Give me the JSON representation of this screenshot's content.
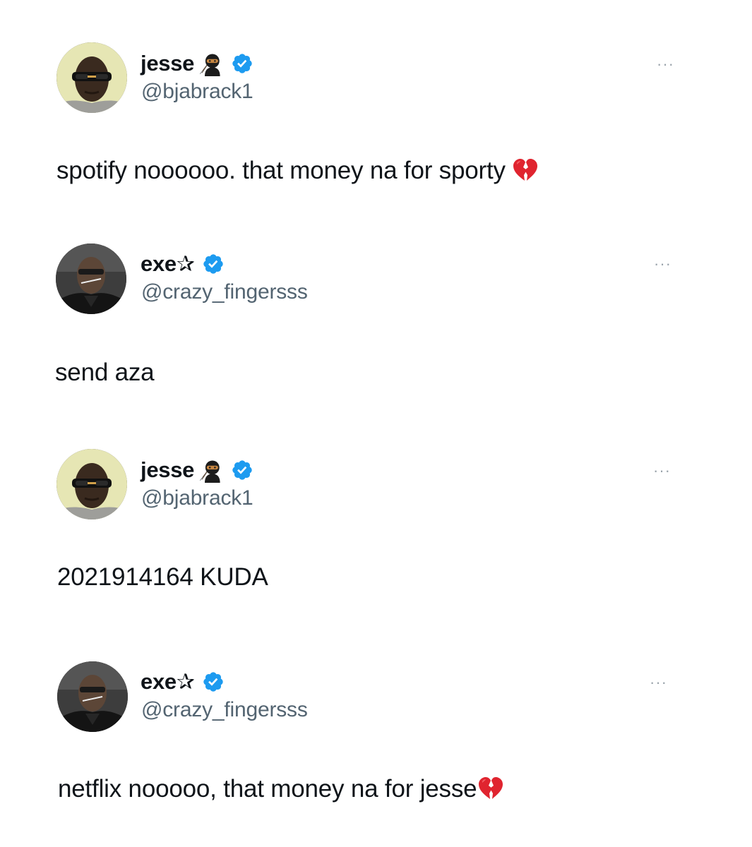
{
  "tweets": [
    {
      "display_name": "jesse",
      "name_emoji": "ninja-emoji",
      "verified": true,
      "handle": "@bjabrack1",
      "more": "···",
      "text": "spotify noooooo. that money na for sporty",
      "trailing_emoji": "broken-heart-emoji"
    },
    {
      "display_name": "exe✰",
      "verified": true,
      "handle": "@crazy_fingersss",
      "more": "···",
      "text": "send aza"
    },
    {
      "display_name": "jesse",
      "name_emoji": "ninja-emoji",
      "verified": true,
      "handle": "@bjabrack1",
      "more": "···",
      "text": "2021914164 KUDA"
    },
    {
      "display_name": "exe✰",
      "verified": true,
      "handle": "@crazy_fingersss",
      "more": "···",
      "text": "netflix nooooo, that money na for jesse",
      "trailing_emoji": "broken-heart-emoji"
    }
  ],
  "colors": {
    "verified_blue": "#1d9bf0",
    "handle_gray": "#536471",
    "text": "#0f1419",
    "broken_heart": "#e0242f"
  }
}
